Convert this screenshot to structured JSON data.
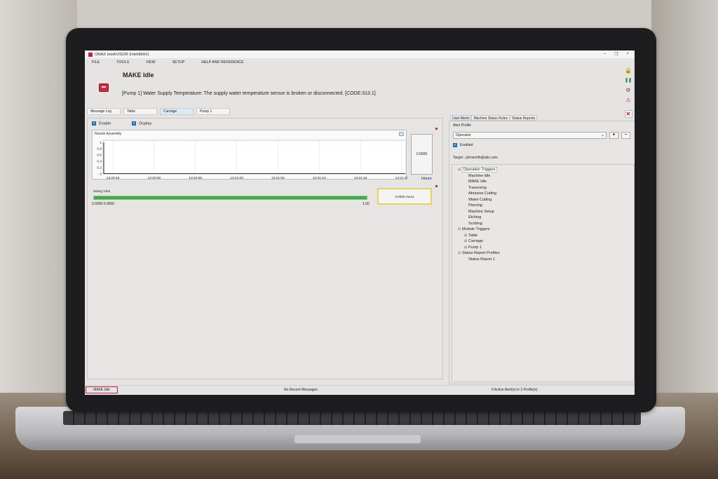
{
  "window": {
    "title": "OMAX IntelliVISOR (IntelliMAX)",
    "minimize": "–",
    "restore": "❐",
    "close": "×"
  },
  "menu": [
    "FILE",
    "TOOLS",
    "VIEW",
    "SETUP",
    "HELP AND REFERENCE"
  ],
  "status": {
    "title": "MAKE Idle",
    "message": "[Pump 1] Water Supply Temperature: The supply water temperature sensor is broken or disconnected. [CODE:313.1]"
  },
  "left_tabs": [
    "Message Log",
    "Table",
    "Carriage",
    "Pump 1"
  ],
  "left_panel": {
    "enable_label": "Enable",
    "display_label": "Display",
    "chart_title": "Nozzle Assembly",
    "side_value": "0.0000",
    "side_unit": "Hours",
    "progress_label": "Mixing Tube",
    "progress_values": "0.0000  0.0000",
    "progress_max": "1.00",
    "progress_fraction": 1.0,
    "hours_box": "0.0000 Hours"
  },
  "chart_data": {
    "type": "line",
    "title": "Nozzle Assembly",
    "x": [
      "13:20:45",
      "13:20:50",
      "13:20:55",
      "13:21:00",
      "13:21:05",
      "13:21:10",
      "13:21:15",
      "13:21:20"
    ],
    "yticks": [
      "1",
      "0.8",
      "0.6",
      "0.4",
      "0.2",
      "0"
    ],
    "series": [
      {
        "values": [
          0,
          0,
          0,
          0,
          0,
          0,
          0,
          0
        ]
      }
    ],
    "ylim": [
      0,
      1
    ],
    "grid": true
  },
  "right_tabs": [
    "User Alerts",
    "Machine Status Rules",
    "Status Reports"
  ],
  "alerts": {
    "profile_label": "Alert Profile",
    "profile_value": "Operator",
    "add": "+",
    "remove": "−",
    "enabled_label": "Enabled",
    "target": "Target - johnsmith@abc.com"
  },
  "tree": [
    {
      "label": "Operation Triggers",
      "level": 0,
      "exp": "⊟",
      "selected": true
    },
    {
      "label": "Machine Idle",
      "level": 1
    },
    {
      "label": "MAKE Idle",
      "level": 1
    },
    {
      "label": "Traversing",
      "level": 1
    },
    {
      "label": "Abrasive Cutting",
      "level": 1
    },
    {
      "label": "Water Cutting",
      "level": 1
    },
    {
      "label": "Piercing",
      "level": 1
    },
    {
      "label": "Machine Setup",
      "level": 1
    },
    {
      "label": "Etching",
      "level": 1
    },
    {
      "label": "Scribing",
      "level": 1
    },
    {
      "label": "Module Triggers",
      "level": 0,
      "exp": "⊟"
    },
    {
      "label": "Table",
      "level": 1,
      "exp": "⊞"
    },
    {
      "label": "Carriage",
      "level": 1,
      "exp": "⊞"
    },
    {
      "label": "Pump 1",
      "level": 1,
      "exp": "⊞"
    },
    {
      "label": "Status Report Profiles",
      "level": 0,
      "exp": "⊟"
    },
    {
      "label": "Status Report 1",
      "level": 1
    }
  ],
  "statusbar": {
    "left": "MAKE Idle",
    "middle": "No Recent Messages",
    "right": "0 Active Alert(s) in 3 Profile(s)"
  }
}
